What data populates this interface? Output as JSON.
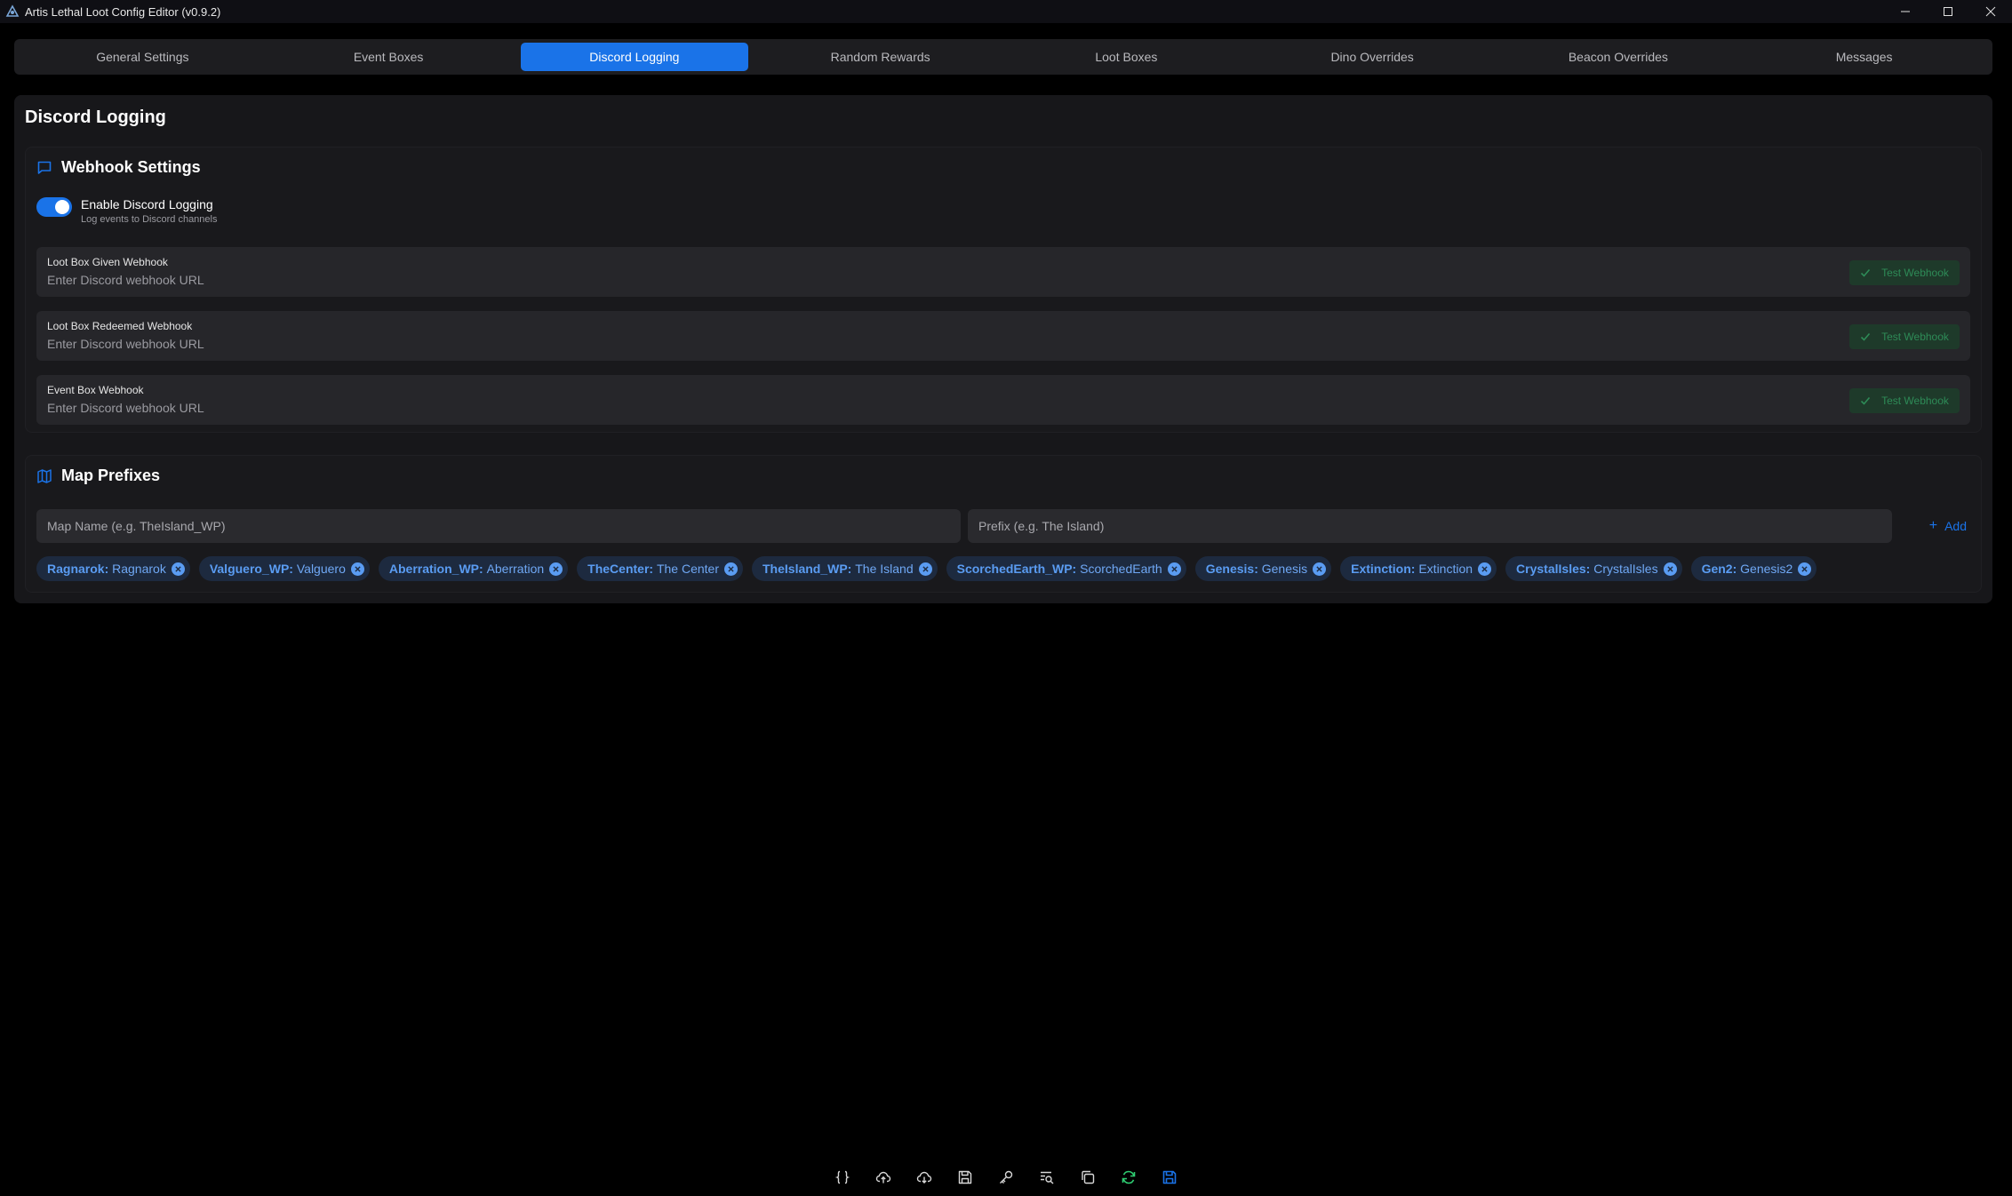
{
  "window": {
    "title": "Artis Lethal Loot Config Editor (v0.9.2)"
  },
  "tabs": [
    {
      "label": "General Settings",
      "active": false
    },
    {
      "label": "Event Boxes",
      "active": false
    },
    {
      "label": "Discord Logging",
      "active": true
    },
    {
      "label": "Random Rewards",
      "active": false
    },
    {
      "label": "Loot Boxes",
      "active": false
    },
    {
      "label": "Dino Overrides",
      "active": false
    },
    {
      "label": "Beacon Overrides",
      "active": false
    },
    {
      "label": "Messages",
      "active": false
    }
  ],
  "page": {
    "title": "Discord Logging"
  },
  "webhook_settings": {
    "title": "Webhook Settings",
    "icon": "message-square-icon",
    "toggle": {
      "label": "Enable Discord Logging",
      "description": "Log events to Discord channels",
      "enabled": true
    },
    "webhooks": [
      {
        "label": "Loot Box Given Webhook",
        "placeholder": "Enter Discord webhook URL",
        "value": "",
        "button": "Test Webhook"
      },
      {
        "label": "Loot Box Redeemed Webhook",
        "placeholder": "Enter Discord webhook URL",
        "value": "",
        "button": "Test Webhook"
      },
      {
        "label": "Event Box Webhook",
        "placeholder": "Enter Discord webhook URL",
        "value": "",
        "button": "Test Webhook"
      }
    ]
  },
  "map_prefixes": {
    "title": "Map Prefixes",
    "icon": "map-icon",
    "map_name_placeholder": "Map Name (e.g. TheIsland_WP)",
    "prefix_placeholder": "Prefix (e.g. The Island)",
    "add_label": "Add",
    "chips": [
      {
        "key": "Ragnarok:",
        "value": "Ragnarok"
      },
      {
        "key": "Valguero_WP:",
        "value": "Valguero"
      },
      {
        "key": "Aberration_WP:",
        "value": "Aberration"
      },
      {
        "key": "TheCenter:",
        "value": "The Center"
      },
      {
        "key": "TheIsland_WP:",
        "value": "The Island"
      },
      {
        "key": "ScorchedEarth_WP:",
        "value": "ScorchedEarth"
      },
      {
        "key": "Genesis:",
        "value": "Genesis"
      },
      {
        "key": "Extinction:",
        "value": "Extinction"
      },
      {
        "key": "CrystalIsles:",
        "value": "CrystalIsles"
      },
      {
        "key": "Gen2:",
        "value": "Genesis2"
      }
    ]
  },
  "toolbar": {
    "icons": [
      "braces-icon",
      "cloud-upload-icon",
      "cloud-download-icon",
      "save-file-icon",
      "key-icon",
      "search-list-icon",
      "copy-icon",
      "refresh-icon",
      "save-icon"
    ]
  },
  "colors": {
    "accent": "#1a73e8",
    "success": "#2e8b57",
    "background": "#000000",
    "panel": "#17171a"
  }
}
